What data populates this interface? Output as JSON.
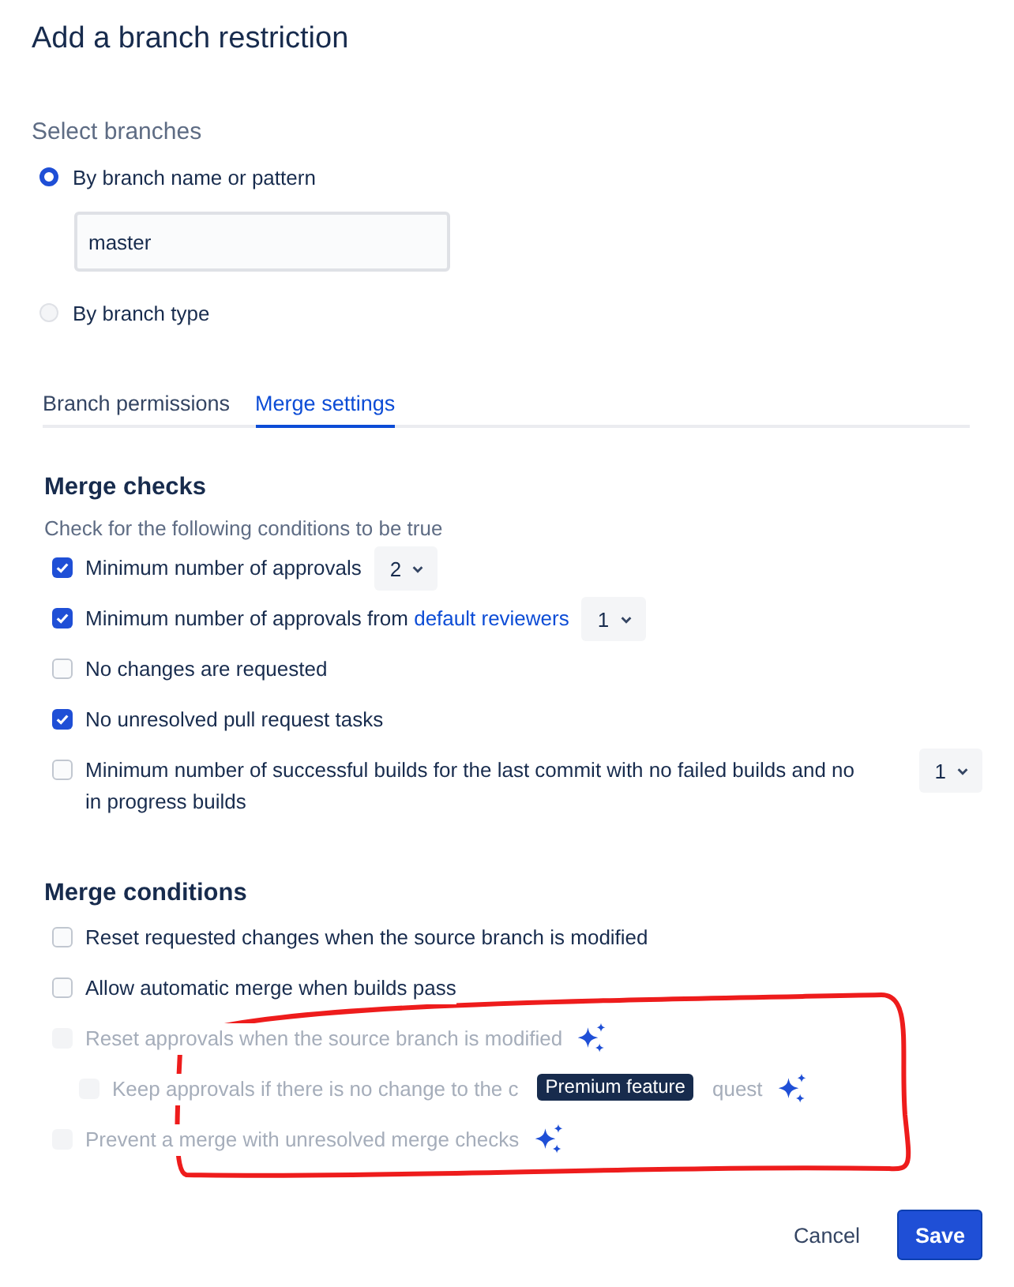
{
  "title": "Add a branch restriction",
  "branches": {
    "heading": "Select branches",
    "options": [
      {
        "label": "By branch name or pattern",
        "selected": true,
        "value": "master"
      },
      {
        "label": "By branch type",
        "selected": false
      }
    ]
  },
  "tabs": [
    {
      "label": "Branch permissions",
      "selected": false
    },
    {
      "label": "Merge settings",
      "selected": true
    }
  ],
  "merge_checks": {
    "heading": "Merge checks",
    "description": "Check for the following conditions to be true",
    "items": [
      {
        "label": "Minimum number of approvals",
        "checked": true,
        "select": "2"
      },
      {
        "label": "Minimum number of approvals from",
        "link": "default reviewers",
        "checked": true,
        "select": "1"
      },
      {
        "label": "No changes are requested",
        "checked": false
      },
      {
        "label": "No unresolved pull request tasks",
        "checked": true
      },
      {
        "label": "Minimum number of successful builds for the last commit with no failed builds and no in progress builds",
        "checked": false,
        "select": "1"
      }
    ]
  },
  "merge_conditions": {
    "heading": "Merge conditions",
    "items": [
      {
        "label": "Reset requested changes when the source branch is modified",
        "checked": false,
        "disabled": false,
        "premium": false
      },
      {
        "label": "Allow automatic merge when builds pass",
        "checked": false,
        "disabled": false,
        "premium": false
      },
      {
        "label": "Reset approvals when the source branch is modified",
        "checked": false,
        "disabled": true,
        "premium": true,
        "children": [
          {
            "label": "Keep approvals if there is no change to the c",
            "label_end": "quest",
            "tooltip": "Premium feature",
            "checked": false,
            "disabled": true,
            "premium": true
          }
        ]
      },
      {
        "label": "Prevent a merge with unresolved merge checks",
        "checked": false,
        "disabled": true,
        "premium": true
      }
    ]
  },
  "buttons": [
    {
      "label": "Cancel",
      "kind": "subtle"
    },
    {
      "label": "Save",
      "kind": "primary"
    }
  ]
}
